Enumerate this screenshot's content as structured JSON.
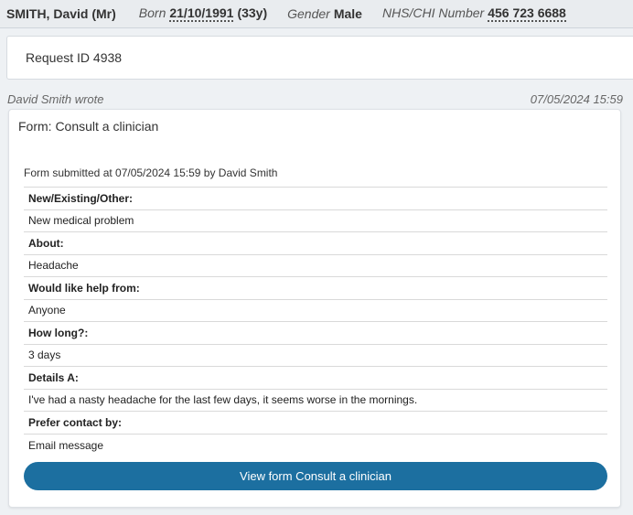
{
  "patient": {
    "name": "SMITH, David (Mr)",
    "born_label": "Born",
    "born_value": "21/10/1991",
    "age": "(33y)",
    "gender_label": "Gender",
    "gender_value": "Male",
    "nhs_label": "NHS/CHI Number",
    "nhs_value": "456 723 6688"
  },
  "request": {
    "title": "Request ID 4938"
  },
  "message": {
    "author_line": "David Smith wrote",
    "timestamp": "07/05/2024 15:59",
    "form_title": "Form: Consult a clinician",
    "submitted_text": "Form submitted at 07/05/2024 15:59 by David Smith",
    "qa": [
      {
        "question": "New/Existing/Other:",
        "answer": "New medical problem"
      },
      {
        "question": "About:",
        "answer": "Headache"
      },
      {
        "question": "Would like help from:",
        "answer": "Anyone"
      },
      {
        "question": "How long?:",
        "answer": "3 days"
      },
      {
        "question": "Details A:",
        "answer": "I've had a nasty headache for the last few days, it seems worse in the mornings."
      },
      {
        "question": "Prefer contact by:",
        "answer": "Email message"
      }
    ],
    "view_button": "View form Consult a clinician"
  }
}
